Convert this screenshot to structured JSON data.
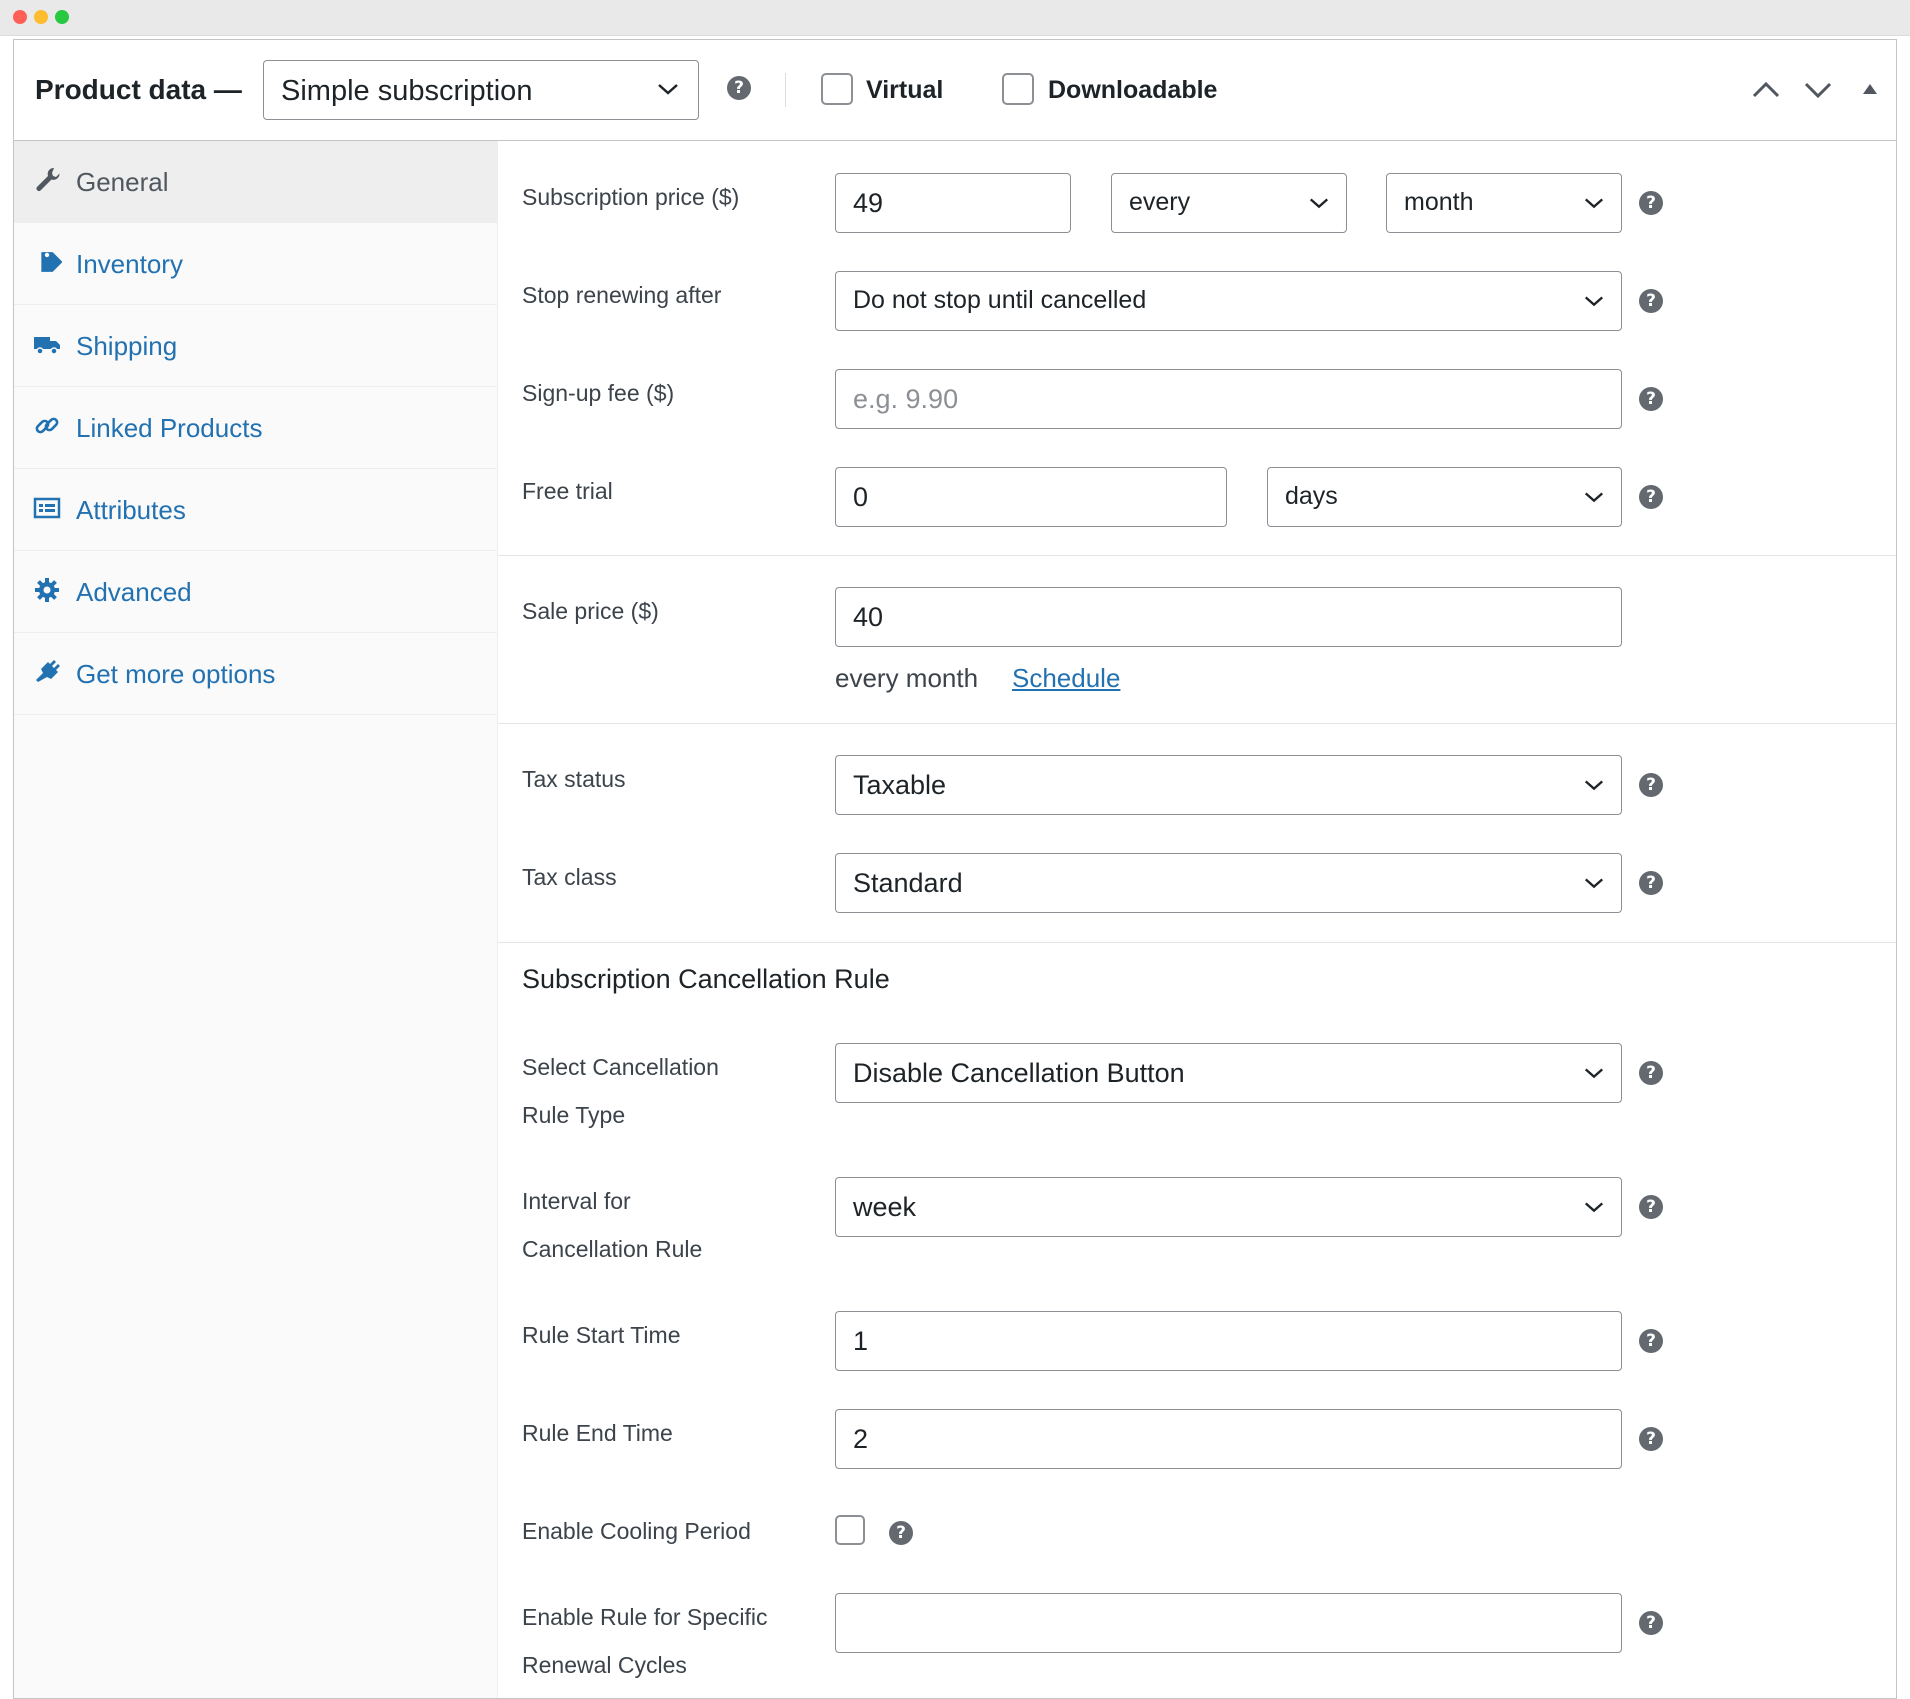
{
  "header": {
    "title": "Product data —",
    "product_type": "Simple subscription",
    "virtual_label": "Virtual",
    "downloadable_label": "Downloadable"
  },
  "sidebar": {
    "items": [
      {
        "label": "General",
        "icon": "wrench-icon",
        "active": true
      },
      {
        "label": "Inventory",
        "icon": "tag-icon"
      },
      {
        "label": "Shipping",
        "icon": "truck-icon"
      },
      {
        "label": "Linked Products",
        "icon": "link-icon"
      },
      {
        "label": "Attributes",
        "icon": "list-icon"
      },
      {
        "label": "Advanced",
        "icon": "gear-icon"
      },
      {
        "label": "Get more options",
        "icon": "plugin-icon"
      }
    ]
  },
  "form": {
    "subscription_price": {
      "label": "Subscription price ($)",
      "value": "49",
      "interval": "every",
      "period": "month"
    },
    "stop_renewing": {
      "label": "Stop renewing after",
      "value": "Do not stop until cancelled"
    },
    "signup_fee": {
      "label": "Sign-up fee ($)",
      "placeholder": "e.g. 9.90"
    },
    "free_trial": {
      "label": "Free trial",
      "value": "0",
      "period": "days"
    },
    "sale_price": {
      "label": "Sale price ($)",
      "value": "40",
      "suffix": "every month",
      "schedule_link": "Schedule"
    },
    "tax_status": {
      "label": "Tax status",
      "value": "Taxable"
    },
    "tax_class": {
      "label": "Tax class",
      "value": "Standard"
    },
    "cancellation": {
      "section_title": "Subscription Cancellation Rule",
      "rule_type": {
        "label_line1": "Select Cancellation",
        "label_line2": "Rule Type",
        "value": "Disable Cancellation Button"
      },
      "interval": {
        "label_line1": "Interval for",
        "label_line2": "Cancellation Rule",
        "value": "week"
      },
      "start_time": {
        "label": "Rule Start Time",
        "value": "1"
      },
      "end_time": {
        "label": "Rule End Time",
        "value": "2"
      },
      "cooling_period": {
        "label": "Enable Cooling Period",
        "checked": false
      },
      "renewal_cycles": {
        "label_line1": "Enable Rule for Specific",
        "label_line2": "Renewal Cycles",
        "value": ""
      }
    }
  },
  "colors": {
    "link": "#2271b1",
    "help_badge": "#646970",
    "border": "#8c8f94"
  }
}
